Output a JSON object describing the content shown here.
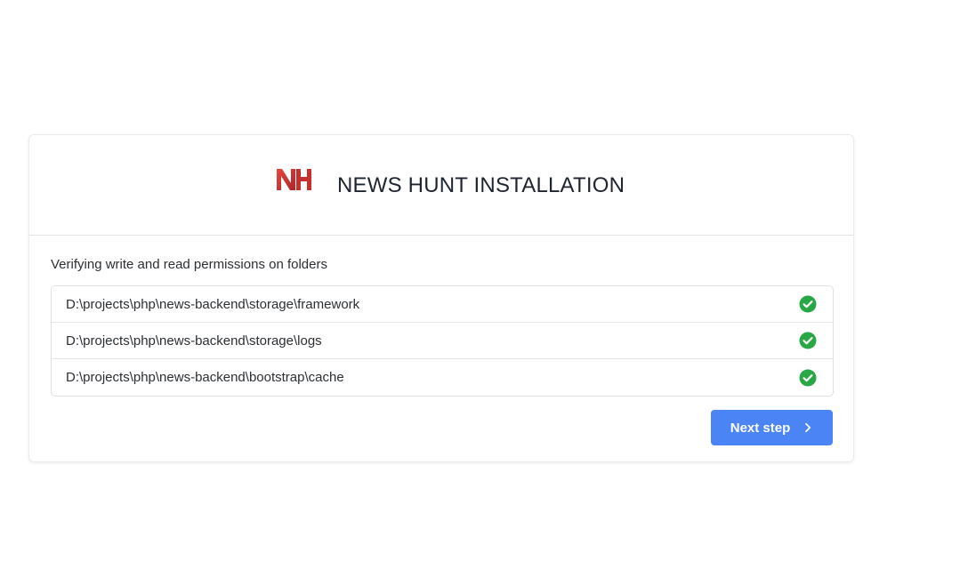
{
  "header": {
    "title": "NEWS HUNT INSTALLATION",
    "logo_icon": "news-hunt-logo",
    "logo_color": "#d93a3a"
  },
  "body": {
    "intro": "Verifying write and read permissions on folders",
    "folders": [
      {
        "path": "D:\\projects\\php\\news-backend\\storage\\framework",
        "status_icon": "check-circle-icon",
        "ok": true
      },
      {
        "path": "D:\\projects\\php\\news-backend\\storage\\logs",
        "status_icon": "check-circle-icon",
        "ok": true
      },
      {
        "path": "D:\\projects\\php\\news-backend\\bootstrap\\cache",
        "status_icon": "check-circle-icon",
        "ok": true
      }
    ]
  },
  "actions": {
    "next_label": "Next step",
    "next_icon": "chevron-right-icon",
    "button_color": "#4a84f5",
    "success_color": "#28a745"
  }
}
